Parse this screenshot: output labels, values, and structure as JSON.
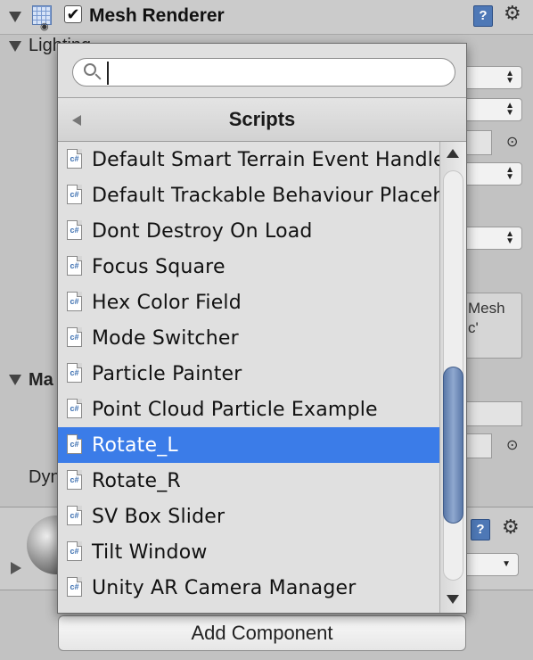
{
  "inspector": {
    "component_title": "Mesh Renderer",
    "lighting_label": "Lighting",
    "materials_label": "Ma",
    "dynamic_label": "Dyn",
    "help_text": "Mesh\nc'",
    "enabled": true,
    "enabled_mark": "✔"
  },
  "popup": {
    "search": {
      "value": "",
      "placeholder": ""
    },
    "category": "Scripts",
    "items": [
      {
        "label": "Default Smart Terrain Event Handler",
        "icon": "csharp-script-icon",
        "selected": false
      },
      {
        "label": "Default Trackable Behaviour Placehol",
        "icon": "csharp-script-icon",
        "selected": false
      },
      {
        "label": "Dont Destroy On Load",
        "icon": "csharp-script-icon",
        "selected": false
      },
      {
        "label": "Focus Square",
        "icon": "csharp-script-icon",
        "selected": false
      },
      {
        "label": "Hex Color Field",
        "icon": "csharp-script-icon",
        "selected": false
      },
      {
        "label": "Mode Switcher",
        "icon": "csharp-script-icon",
        "selected": false
      },
      {
        "label": "Particle Painter",
        "icon": "csharp-script-icon",
        "selected": false
      },
      {
        "label": "Point Cloud Particle Example",
        "icon": "csharp-script-icon",
        "selected": false
      },
      {
        "label": "Rotate_L",
        "icon": "csharp-script-icon",
        "selected": true
      },
      {
        "label": "Rotate_R",
        "icon": "csharp-script-icon",
        "selected": false
      },
      {
        "label": "SV Box Slider",
        "icon": "csharp-script-icon",
        "selected": false
      },
      {
        "label": "Tilt Window",
        "icon": "csharp-script-icon",
        "selected": false
      },
      {
        "label": "Unity AR Camera Manager",
        "icon": "csharp-script-icon",
        "selected": false
      }
    ],
    "file_icon_glyph": "c#",
    "colors": {
      "selection": "#3b7ce8",
      "scroll_thumb": "#7088b8"
    }
  },
  "add_component_label": "Add Component"
}
